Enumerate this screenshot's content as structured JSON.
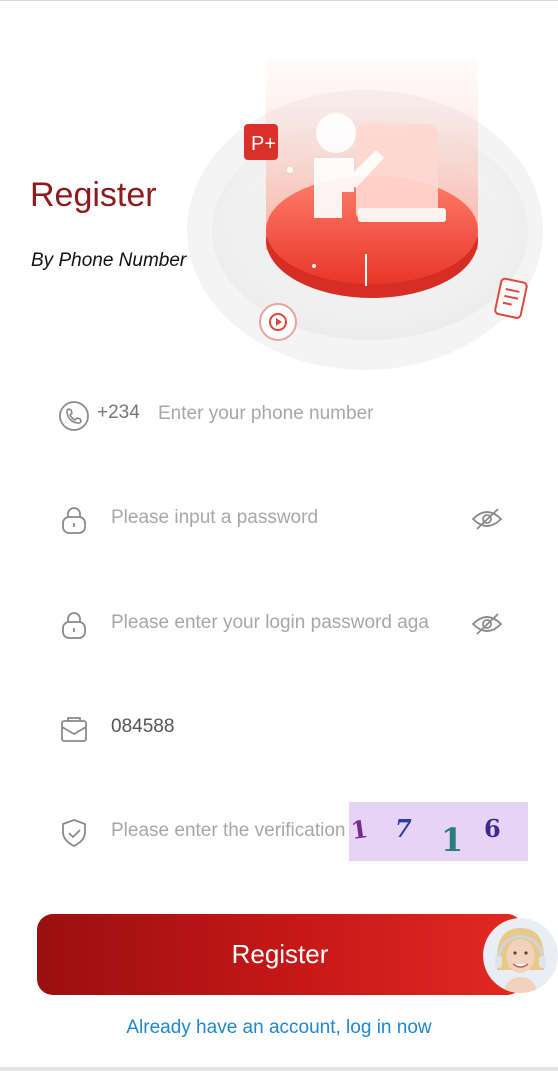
{
  "header": {
    "title": "Register",
    "subtitle": "By Phone Number"
  },
  "form": {
    "phone": {
      "prefix": "+234",
      "placeholder": "Enter your phone number",
      "value": "",
      "icon": "phone-icon"
    },
    "password": {
      "placeholder": "Please input a password",
      "value": "",
      "icon": "lock-icon",
      "toggle_icon": "eye-hidden-icon"
    },
    "confirm_password": {
      "placeholder": "Please enter your login password aga",
      "value": "",
      "icon": "lock-icon",
      "toggle_icon": "eye-hidden-icon"
    },
    "invite_code": {
      "placeholder": "",
      "value": "084588",
      "icon": "envelope-icon"
    },
    "verification": {
      "placeholder": "Please enter the verification code",
      "value": "",
      "icon": "shield-check-icon",
      "captcha": [
        "1",
        "7",
        "1",
        "6"
      ]
    }
  },
  "actions": {
    "register_label": "Register",
    "login_link": "Already have an account, log in now"
  },
  "colors": {
    "title": "#8e1b1b",
    "button_start": "#9b0f0f",
    "button_end": "#e22a22",
    "link": "#1f86cf",
    "captcha_bg": "#e7d3f5"
  }
}
